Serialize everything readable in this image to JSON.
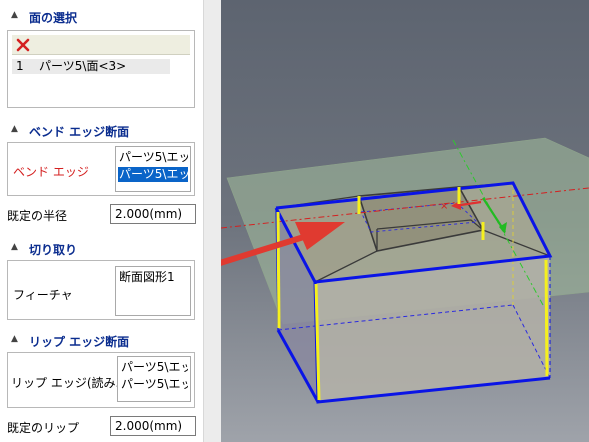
{
  "face_selection": {
    "title": "面の選択",
    "rows": [
      {
        "index": "1",
        "value": "パーツ5\\面<3>"
      }
    ]
  },
  "bend_edge_section": {
    "title": "ベンド エッジ断面",
    "field_label": "ベンド エッジ",
    "items": [
      "パーツ5\\エッ",
      "パーツ5\\エッ"
    ],
    "selected_index": 1
  },
  "default_radius": {
    "label": "既定の半径",
    "value": "2.000(mm)"
  },
  "cutout_section": {
    "title": "切り取り",
    "field_label": "フィーチャ",
    "items": [
      "断面図形1"
    ]
  },
  "lip_edge_section": {
    "title": "リップ エッジ断面",
    "field_label": "リップ エッジ(読み...",
    "items": [
      "パーツ5\\エッ",
      "パーツ5\\エッ"
    ]
  },
  "default_lip": {
    "label": "既定のリップ",
    "value": "2.000(mm)"
  },
  "colors": {
    "section_title": "#0b2d8f",
    "bend_label": "#d42020",
    "selection": "#0a64c8",
    "edge_blue": "#0a14e6",
    "edge_yellow": "#f5f01e",
    "arrow_red": "#e03a30"
  },
  "icons": [
    "delete-x-icon",
    "chevron-up-icon"
  ]
}
